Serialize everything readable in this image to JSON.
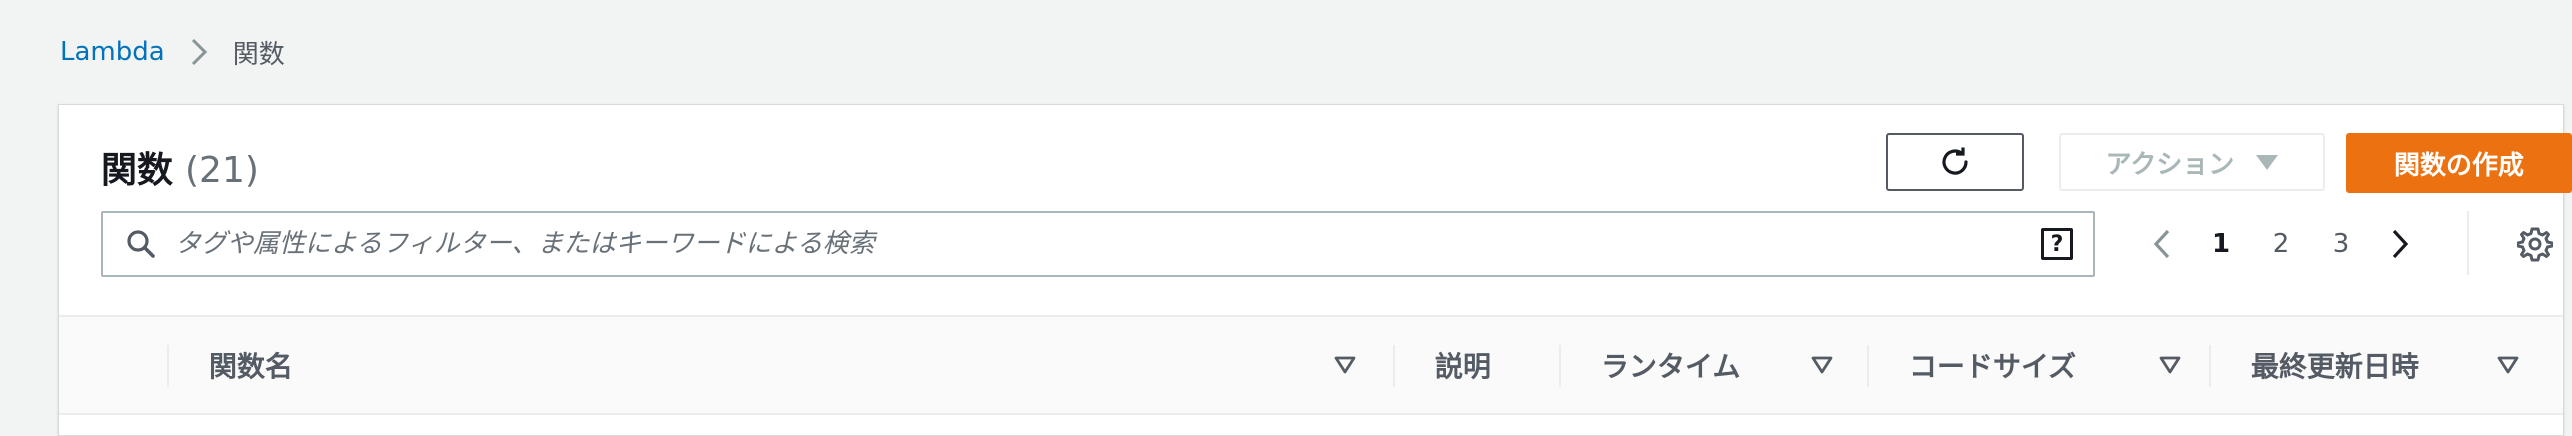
{
  "breadcrumb": {
    "root": "Lambda",
    "current": "関数"
  },
  "panel": {
    "title": "関数",
    "count": "(21)"
  },
  "toolbar": {
    "refresh_icon": "refresh-icon",
    "actions_label": "アクション",
    "create_label": "関数の作成"
  },
  "search": {
    "placeholder": "タグや属性によるフィルター、またはキーワードによる検索",
    "value": "",
    "help_label": "?"
  },
  "pagination": {
    "pages": [
      "1",
      "2",
      "3"
    ],
    "current_page": "1"
  },
  "table": {
    "columns": [
      "関数名",
      "説明",
      "ランタイム",
      "コードサイズ",
      "最終更新日時"
    ]
  },
  "colors": {
    "primary_button": "#ec7211",
    "link": "#0073bb",
    "highlight": "#e8351a"
  }
}
